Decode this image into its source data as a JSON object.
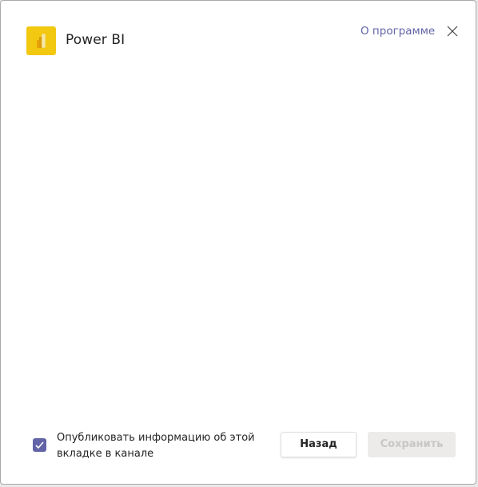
{
  "header": {
    "app_icon": "power-bi-icon",
    "app_title": "Power BI",
    "about_link": "О программе",
    "close_icon": "close-icon",
    "accent_color": "#6264a7",
    "brand_color": "#f2c811"
  },
  "footer": {
    "publish_checkbox": {
      "checked": true,
      "label": "Опубликовать информацию об этой вкладке в канале"
    },
    "back_button": "Назад",
    "save_button": "Сохранить",
    "save_button_disabled": true
  }
}
